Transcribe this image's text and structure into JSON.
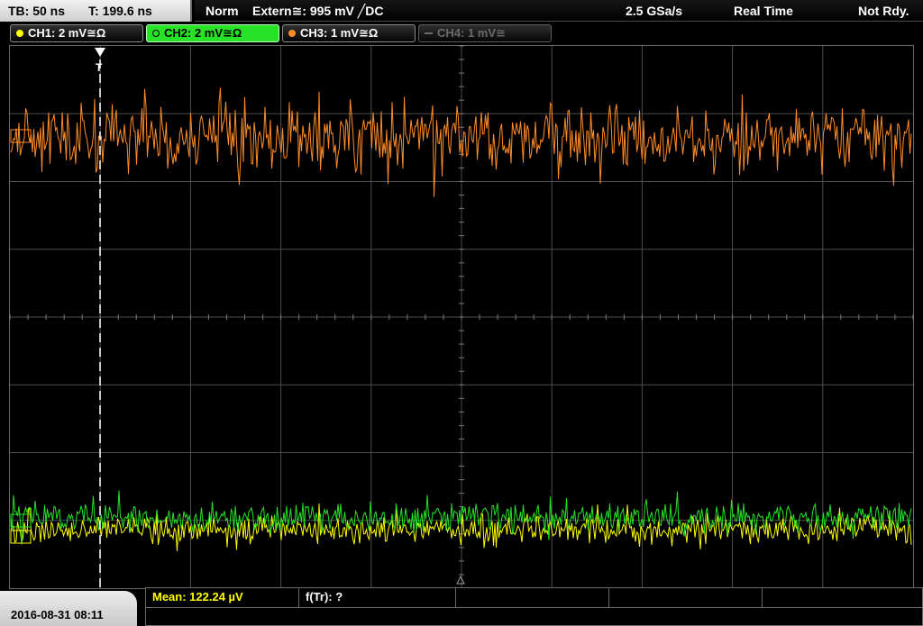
{
  "timebase": {
    "tb": "TB: 50 ns",
    "trigger_time": "T: 199.6 ns"
  },
  "status": {
    "mode": "Norm",
    "trigger": "Extern≅: 995 mV ╱DC",
    "sample_rate": "2.5 GSa/s",
    "acquisition": "Real Time",
    "state": "Not Rdy."
  },
  "channels": [
    {
      "label": "CH1: 2 mV≅Ω",
      "color": "#ffff00"
    },
    {
      "label": "CH2: 2 mV≅Ω",
      "color": "#28e228"
    },
    {
      "label": "CH3: 1 mV≅Ω",
      "color": "#ff8c28"
    },
    {
      "label": "CH4: 1 mV≅",
      "color": "#6a6a6a"
    }
  ],
  "trigger_marker": "T",
  "datetime": "2016-08-31 08:11",
  "measurements": {
    "mean": "Mean: 122.24 µV",
    "rise": "f(Tr): ?"
  },
  "colors": {
    "grid": "#4d4d4d",
    "grid_center": "#7a7a7a",
    "trace_ch3": "#ff8c28",
    "trace_ch2": "#28e228",
    "trace_ch1": "#ffff00",
    "mean_text": "#ffff00"
  }
}
